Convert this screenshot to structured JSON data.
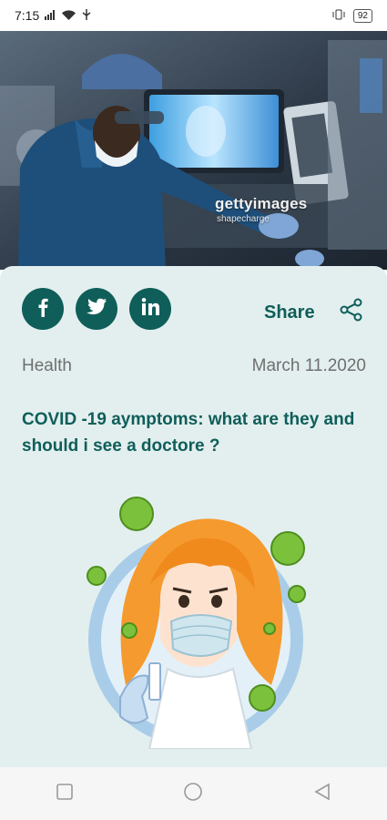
{
  "status_bar": {
    "time": "7:15",
    "battery": "92"
  },
  "hero": {
    "watermark": "gettyimages",
    "watermark_sub": "shapecharge"
  },
  "article": {
    "share_label": "Share",
    "category": "Health",
    "date": "March 11.2020",
    "headline": "COVID -19 aymptoms: what are they and should i see a doctore ?"
  },
  "social": [
    {
      "icon": "facebook-icon"
    },
    {
      "icon": "twitter-icon"
    },
    {
      "icon": "linkedin-icon"
    }
  ],
  "nav": [
    {
      "icon": "recents-icon"
    },
    {
      "icon": "home-icon"
    },
    {
      "icon": "back-icon"
    }
  ],
  "colors": {
    "accent": "#0f5e59",
    "card_background": "#e3efef",
    "meta_text": "#6f6f6f"
  }
}
